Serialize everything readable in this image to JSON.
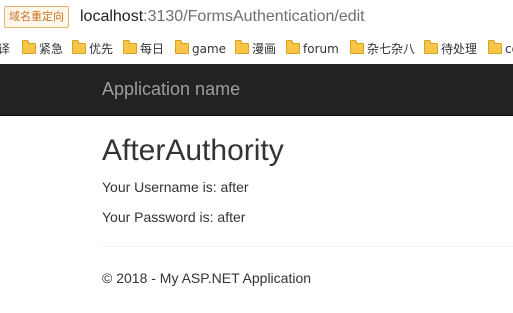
{
  "browser": {
    "redirect_badge": "域名重定向",
    "url_host": "localhost",
    "url_path": ":3130/FormsAuthentication/edit"
  },
  "bookmarks": [
    {
      "label": "译",
      "icon": "none"
    },
    {
      "label": "紧急",
      "icon": "folder-icon"
    },
    {
      "label": "优先",
      "icon": "folder-icon"
    },
    {
      "label": "每日",
      "icon": "folder-icon"
    },
    {
      "label": "game",
      "icon": "folder-icon"
    },
    {
      "label": "漫画",
      "icon": "folder-icon"
    },
    {
      "label": "forum",
      "icon": "folder-icon"
    },
    {
      "label": "杂七杂八",
      "icon": "folder-icon"
    },
    {
      "label": "待处理",
      "icon": "folder-icon"
    },
    {
      "label": "co",
      "icon": "folder-icon"
    }
  ],
  "navbar": {
    "brand": "Application name"
  },
  "main": {
    "title": "AfterAuthority",
    "username_line": "Your Username is: after",
    "password_line": "Your Password is: after"
  },
  "footer": {
    "text": "© 2018 - My ASP.NET Application"
  },
  "colors": {
    "navbar_bg": "#222222",
    "brand_text": "#9d9d9d",
    "folder": "#f7c548"
  }
}
